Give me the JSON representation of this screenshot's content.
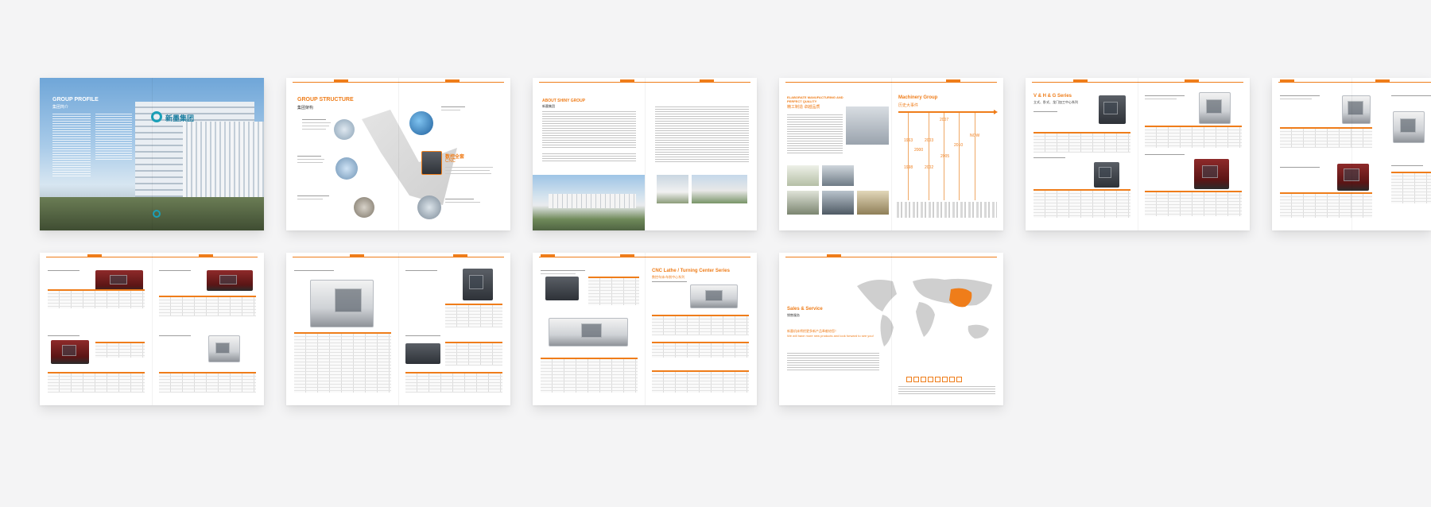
{
  "colors": {
    "accent": "#ef7d1a",
    "background": "#f4f4f5",
    "page": "#ffffff"
  },
  "spreads": {
    "group_profile": {
      "title_en": "GROUP PROFILE",
      "title_cn": "集团简介",
      "building_sign": "新墨集团"
    },
    "group_structure": {
      "title_en": "GROUP STRUCTURE",
      "title_cn": "集团架构",
      "cnc_cn": "数控全套",
      "cnc_en": "CNC"
    },
    "about": {
      "title_en": "ABOUT SHINY GROUP",
      "title_cn": "新墨集团"
    },
    "quality": {
      "title_en_1": "ELABORATE MANUFACTURING AND",
      "title_en_2": "PERFECT QUALITY",
      "title_cn": "精工制造  卓越品质",
      "history_en": "Machinery Group",
      "history_cn": "历史大事件",
      "years": [
        "2007",
        "1963",
        "2003",
        "2010",
        "NOW",
        "2000",
        "2005",
        "2002",
        "1998"
      ]
    },
    "vh_series": {
      "title_en": "V & H & G Series",
      "title_cn": "立式、卧式、龙门加工中心系列"
    },
    "cnc_lathe": {
      "title_en": "CNC Lathe / Turning Center Series",
      "title_cn": "数控车床/车削中心系列"
    },
    "sales": {
      "title_en": "Sales & Service",
      "title_cn": "销售服务",
      "slogan_cn": "新墨机床将把更多新产品奉献给您！",
      "slogan_en": "We will have more new products and look forward to see you!"
    }
  }
}
